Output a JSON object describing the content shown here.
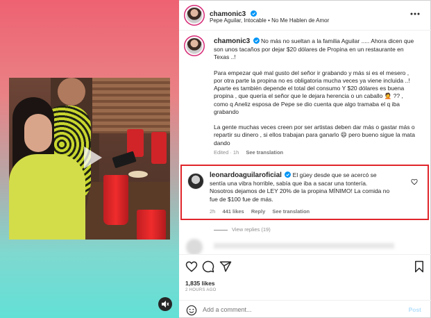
{
  "post": {
    "username": "chamonic3",
    "audio": "Pepe Aguilar, Intocable • No Me Hablen de Amor"
  },
  "caption": {
    "username": "chamonic3",
    "text": "No más no sueltan a la familia Aguilar ..... Ahora dicen que son unos tacaños por dejar $20 dólares de Propina en un restaurante en Texas ..!\n\nPara empezar qué mal gusto del señor ir grabando y más si es el mesero , por otra parte la propina no es obligatoria mucha veces ya viene incluida ..! Aparte es también depende el total del consumo Y $20 dólares es buena propina , que quería el señor que le dejara herencia o un caballo 🤦 ?? , como q Aneliz esposa de Pepe se dio cuenta que algo tramaba el q iba grabando\n\nLa gente muchas veces creen por ser artistas deben dar más o gastar más o repartir su dinero , si ellos trabajan para ganarlo 😄 pero bueno sigue la mata dando",
    "edited": "Edited · 1h",
    "see_translation": "See translation"
  },
  "comment": {
    "username": "leonardoaguilaroficial",
    "text": "El güey desde que se acercó se sentía una vibra horrible, sabía que iba a sacar una tontería. Nosotros dejamos de LEY 20% de la propina MÍNIMO! La comida no fue de $100 fue de más.",
    "time": "2h",
    "likes": "441 likes",
    "reply": "Reply",
    "see_translation": "See translation",
    "view_replies": "View replies (19)"
  },
  "stats": {
    "likes": "1,835 likes",
    "time": "2 HOURS AGO"
  },
  "add_comment": {
    "placeholder": "Add a comment...",
    "post": "Post"
  },
  "colors": {
    "verified": "#0095f6",
    "highlight": "#e0242a",
    "post_button": "#b2dffc"
  }
}
